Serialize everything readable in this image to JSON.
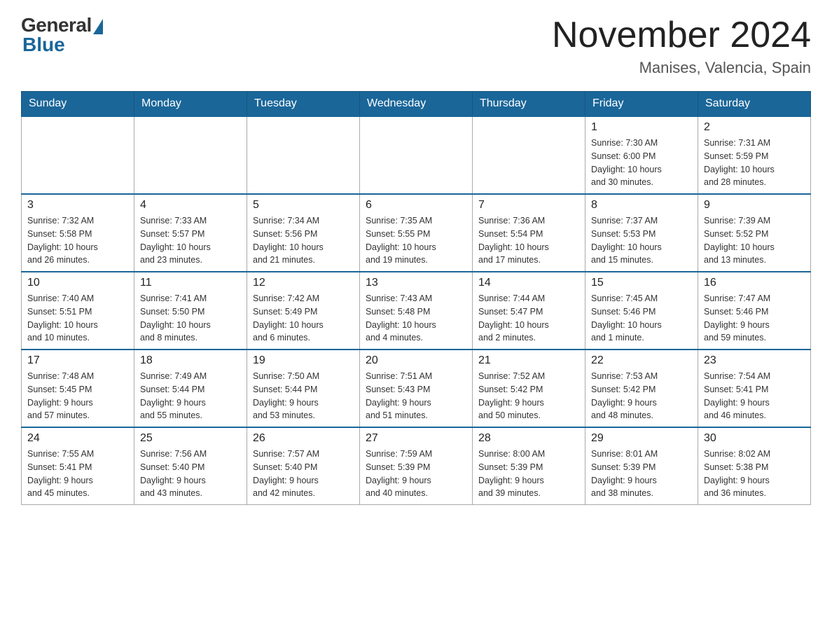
{
  "header": {
    "logo_general": "General",
    "logo_blue": "Blue",
    "month_title": "November 2024",
    "location": "Manises, Valencia, Spain"
  },
  "weekdays": [
    "Sunday",
    "Monday",
    "Tuesday",
    "Wednesday",
    "Thursday",
    "Friday",
    "Saturday"
  ],
  "weeks": [
    [
      {
        "day": "",
        "info": ""
      },
      {
        "day": "",
        "info": ""
      },
      {
        "day": "",
        "info": ""
      },
      {
        "day": "",
        "info": ""
      },
      {
        "day": "",
        "info": ""
      },
      {
        "day": "1",
        "info": "Sunrise: 7:30 AM\nSunset: 6:00 PM\nDaylight: 10 hours\nand 30 minutes."
      },
      {
        "day": "2",
        "info": "Sunrise: 7:31 AM\nSunset: 5:59 PM\nDaylight: 10 hours\nand 28 minutes."
      }
    ],
    [
      {
        "day": "3",
        "info": "Sunrise: 7:32 AM\nSunset: 5:58 PM\nDaylight: 10 hours\nand 26 minutes."
      },
      {
        "day": "4",
        "info": "Sunrise: 7:33 AM\nSunset: 5:57 PM\nDaylight: 10 hours\nand 23 minutes."
      },
      {
        "day": "5",
        "info": "Sunrise: 7:34 AM\nSunset: 5:56 PM\nDaylight: 10 hours\nand 21 minutes."
      },
      {
        "day": "6",
        "info": "Sunrise: 7:35 AM\nSunset: 5:55 PM\nDaylight: 10 hours\nand 19 minutes."
      },
      {
        "day": "7",
        "info": "Sunrise: 7:36 AM\nSunset: 5:54 PM\nDaylight: 10 hours\nand 17 minutes."
      },
      {
        "day": "8",
        "info": "Sunrise: 7:37 AM\nSunset: 5:53 PM\nDaylight: 10 hours\nand 15 minutes."
      },
      {
        "day": "9",
        "info": "Sunrise: 7:39 AM\nSunset: 5:52 PM\nDaylight: 10 hours\nand 13 minutes."
      }
    ],
    [
      {
        "day": "10",
        "info": "Sunrise: 7:40 AM\nSunset: 5:51 PM\nDaylight: 10 hours\nand 10 minutes."
      },
      {
        "day": "11",
        "info": "Sunrise: 7:41 AM\nSunset: 5:50 PM\nDaylight: 10 hours\nand 8 minutes."
      },
      {
        "day": "12",
        "info": "Sunrise: 7:42 AM\nSunset: 5:49 PM\nDaylight: 10 hours\nand 6 minutes."
      },
      {
        "day": "13",
        "info": "Sunrise: 7:43 AM\nSunset: 5:48 PM\nDaylight: 10 hours\nand 4 minutes."
      },
      {
        "day": "14",
        "info": "Sunrise: 7:44 AM\nSunset: 5:47 PM\nDaylight: 10 hours\nand 2 minutes."
      },
      {
        "day": "15",
        "info": "Sunrise: 7:45 AM\nSunset: 5:46 PM\nDaylight: 10 hours\nand 1 minute."
      },
      {
        "day": "16",
        "info": "Sunrise: 7:47 AM\nSunset: 5:46 PM\nDaylight: 9 hours\nand 59 minutes."
      }
    ],
    [
      {
        "day": "17",
        "info": "Sunrise: 7:48 AM\nSunset: 5:45 PM\nDaylight: 9 hours\nand 57 minutes."
      },
      {
        "day": "18",
        "info": "Sunrise: 7:49 AM\nSunset: 5:44 PM\nDaylight: 9 hours\nand 55 minutes."
      },
      {
        "day": "19",
        "info": "Sunrise: 7:50 AM\nSunset: 5:44 PM\nDaylight: 9 hours\nand 53 minutes."
      },
      {
        "day": "20",
        "info": "Sunrise: 7:51 AM\nSunset: 5:43 PM\nDaylight: 9 hours\nand 51 minutes."
      },
      {
        "day": "21",
        "info": "Sunrise: 7:52 AM\nSunset: 5:42 PM\nDaylight: 9 hours\nand 50 minutes."
      },
      {
        "day": "22",
        "info": "Sunrise: 7:53 AM\nSunset: 5:42 PM\nDaylight: 9 hours\nand 48 minutes."
      },
      {
        "day": "23",
        "info": "Sunrise: 7:54 AM\nSunset: 5:41 PM\nDaylight: 9 hours\nand 46 minutes."
      }
    ],
    [
      {
        "day": "24",
        "info": "Sunrise: 7:55 AM\nSunset: 5:41 PM\nDaylight: 9 hours\nand 45 minutes."
      },
      {
        "day": "25",
        "info": "Sunrise: 7:56 AM\nSunset: 5:40 PM\nDaylight: 9 hours\nand 43 minutes."
      },
      {
        "day": "26",
        "info": "Sunrise: 7:57 AM\nSunset: 5:40 PM\nDaylight: 9 hours\nand 42 minutes."
      },
      {
        "day": "27",
        "info": "Sunrise: 7:59 AM\nSunset: 5:39 PM\nDaylight: 9 hours\nand 40 minutes."
      },
      {
        "day": "28",
        "info": "Sunrise: 8:00 AM\nSunset: 5:39 PM\nDaylight: 9 hours\nand 39 minutes."
      },
      {
        "day": "29",
        "info": "Sunrise: 8:01 AM\nSunset: 5:39 PM\nDaylight: 9 hours\nand 38 minutes."
      },
      {
        "day": "30",
        "info": "Sunrise: 8:02 AM\nSunset: 5:38 PM\nDaylight: 9 hours\nand 36 minutes."
      }
    ]
  ]
}
